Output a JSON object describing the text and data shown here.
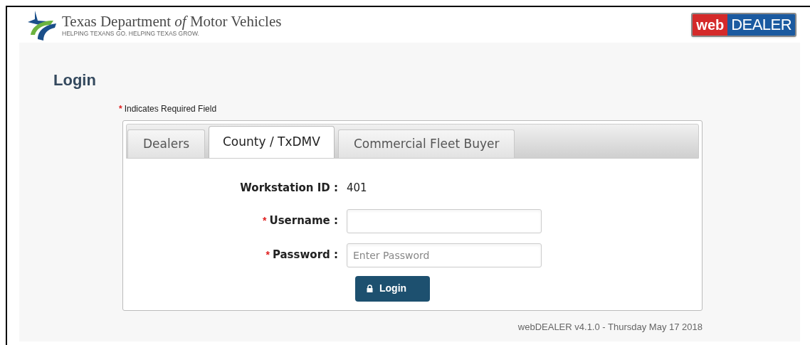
{
  "header": {
    "agency_name": "Texas Department *of* Motor Vehicles",
    "tagline": "HELPING TEXANS GO. HELPING TEXAS GROW.",
    "product_logo": {
      "part_1": "web",
      "part_2": "DEALER"
    }
  },
  "page_title": "Login",
  "required_note": {
    "marker": "*",
    "text": "Indicates Required Field"
  },
  "tabs": [
    {
      "label": "Dealers",
      "selected": false
    },
    {
      "label": "County / TxDMV",
      "selected": true
    },
    {
      "label": "Commercial Fleet Buyer",
      "selected": false
    }
  ],
  "form": {
    "workstation": {
      "label": "Workstation ID :",
      "value": "401"
    },
    "fields": [
      {
        "label": "Username :",
        "required": true
      },
      {
        "label": "Password :",
        "required": true,
        "placeholder": "Enter Password"
      }
    ],
    "submit": "Login"
  },
  "footer": "webDEALER v4.1.0 - Thursday May 17 2018"
}
